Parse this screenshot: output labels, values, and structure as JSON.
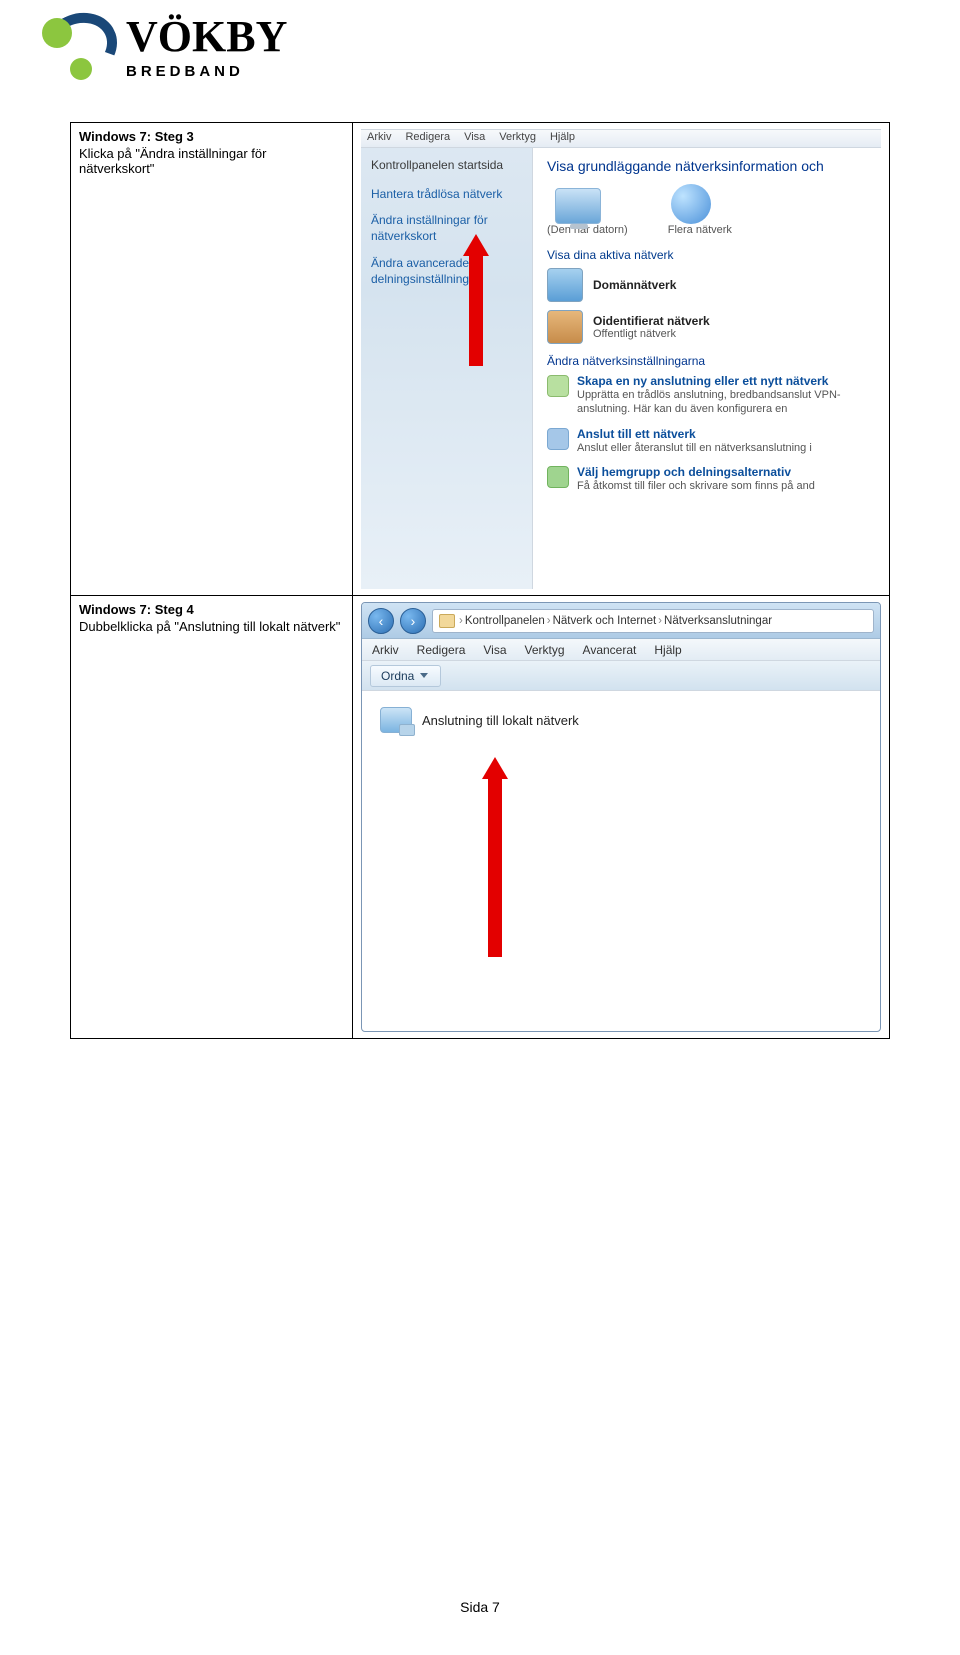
{
  "logo": {
    "brand": "VÖKBY",
    "sub": "BREDBAND"
  },
  "step3": {
    "title": "Windows 7: Steg 3",
    "desc": "Klicka på \"Ändra inställningar för nätverkskort\"",
    "menubar": [
      "Arkiv",
      "Redigera",
      "Visa",
      "Verktyg",
      "Hjälp"
    ],
    "side_home": "Kontrollpanelen startsida",
    "side_links": [
      "Hantera trådlösa nätverk",
      "Ändra inställningar för nätverkskort",
      "Ändra avancerade delningsinställningar"
    ],
    "main_heading": "Visa grundläggande nätverksinformation och",
    "pc_caption": "(Den här datorn)",
    "multi_caption": "Flera nätverk",
    "active_caption": "Visa dina aktiva nätverk",
    "network1": {
      "name": "Domännätverk"
    },
    "network2": {
      "name": "Oidentifierat nätverk",
      "type": "Offentligt nätverk"
    },
    "settings_hdr": "Ändra nätverksinställningarna",
    "task1": {
      "title": "Skapa en ny anslutning eller ett nytt nätverk",
      "desc": "Upprätta en trådlös anslutning, bredbandsanslut VPN-anslutning. Här kan du även konfigurera en"
    },
    "task2": {
      "title": "Anslut till ett nätverk",
      "desc": "Anslut eller återanslut till en nätverksanslutning i"
    },
    "task3": {
      "title": "Välj hemgrupp och delningsalternativ",
      "desc": "Få åtkomst till filer och skrivare som finns på and"
    }
  },
  "step4": {
    "title": "Windows 7: Steg 4",
    "desc": "Dubbelklicka på \"Anslutning till lokalt nätverk\"",
    "breadcrumb": [
      "Kontrollpanelen",
      "Nätverk och Internet",
      "Nätverksanslutningar"
    ],
    "menubar": [
      "Arkiv",
      "Redigera",
      "Visa",
      "Verktyg",
      "Avancerat",
      "Hjälp"
    ],
    "ordna": "Ordna",
    "connection": "Anslutning till lokalt nätverk"
  },
  "footer": "Sida 7"
}
